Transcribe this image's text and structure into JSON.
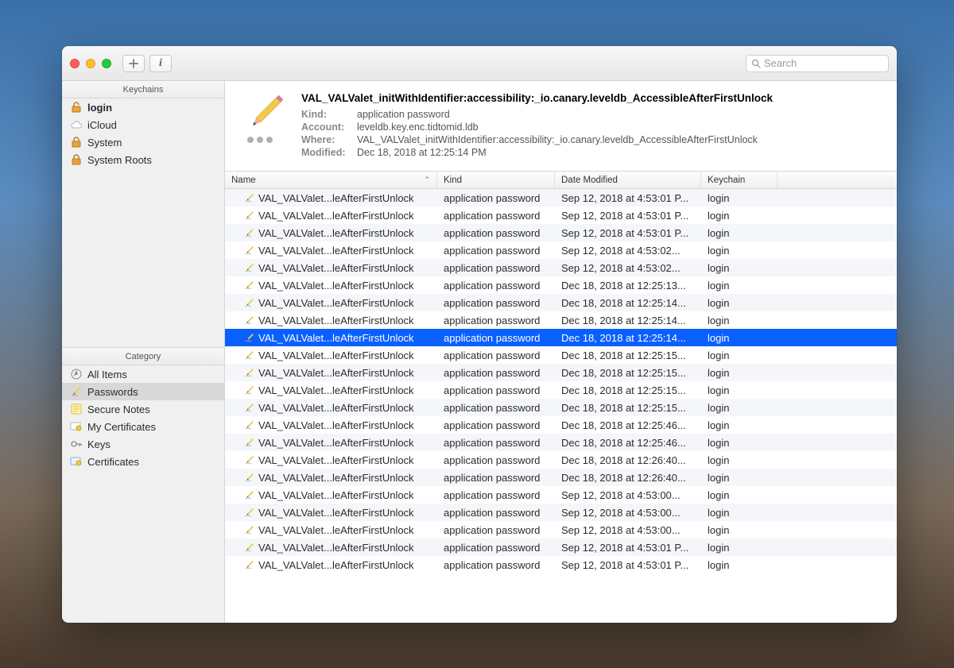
{
  "toolbar": {
    "search_placeholder": "Search"
  },
  "sidebar": {
    "keychains_header": "Keychains",
    "keychains": [
      {
        "label": "login",
        "icon": "lock-open",
        "bold": true
      },
      {
        "label": "iCloud",
        "icon": "cloud"
      },
      {
        "label": "System",
        "icon": "lock"
      },
      {
        "label": "System Roots",
        "icon": "lock"
      }
    ],
    "category_header": "Category",
    "categories": [
      {
        "label": "All Items",
        "icon": "compass",
        "selected": false
      },
      {
        "label": "Passwords",
        "icon": "pencil",
        "selected": true
      },
      {
        "label": "Secure Notes",
        "icon": "note",
        "selected": false
      },
      {
        "label": "My Certificates",
        "icon": "cert",
        "selected": false
      },
      {
        "label": "Keys",
        "icon": "key",
        "selected": false
      },
      {
        "label": "Certificates",
        "icon": "cert-blue",
        "selected": false
      }
    ]
  },
  "detail": {
    "title": "VAL_VALValet_initWithIdentifier:accessibility:_io.canary.leveldb_AccessibleAfterFirstUnlock",
    "kind_label": "Kind:",
    "kind_value": "application password",
    "account_label": "Account:",
    "account_value": "leveldb.key.enc.tidtomid.ldb",
    "where_label": "Where:",
    "where_value": "VAL_VALValet_initWithIdentifier:accessibility:_io.canary.leveldb_AccessibleAfterFirstUnlock",
    "modified_label": "Modified:",
    "modified_value": "Dec 18, 2018 at 12:25:14 PM"
  },
  "columns": {
    "name": "Name",
    "kind": "Kind",
    "date": "Date Modified",
    "keychain": "Keychain"
  },
  "rows": [
    {
      "name": "VAL_VALValet...leAfterFirstUnlock",
      "kind": "application password",
      "date": "Sep 12, 2018 at 4:53:01 P...",
      "keychain": "login"
    },
    {
      "name": "VAL_VALValet...leAfterFirstUnlock",
      "kind": "application password",
      "date": "Sep 12, 2018 at 4:53:01 P...",
      "keychain": "login"
    },
    {
      "name": "VAL_VALValet...leAfterFirstUnlock",
      "kind": "application password",
      "date": "Sep 12, 2018 at 4:53:01 P...",
      "keychain": "login"
    },
    {
      "name": "VAL_VALValet...leAfterFirstUnlock",
      "kind": "application password",
      "date": "Sep 12, 2018 at 4:53:02...",
      "keychain": "login"
    },
    {
      "name": "VAL_VALValet...leAfterFirstUnlock",
      "kind": "application password",
      "date": "Sep 12, 2018 at 4:53:02...",
      "keychain": "login"
    },
    {
      "name": "VAL_VALValet...leAfterFirstUnlock",
      "kind": "application password",
      "date": "Dec 18, 2018 at 12:25:13...",
      "keychain": "login"
    },
    {
      "name": "VAL_VALValet...leAfterFirstUnlock",
      "kind": "application password",
      "date": "Dec 18, 2018 at 12:25:14...",
      "keychain": "login"
    },
    {
      "name": "VAL_VALValet...leAfterFirstUnlock",
      "kind": "application password",
      "date": "Dec 18, 2018 at 12:25:14...",
      "keychain": "login"
    },
    {
      "name": "VAL_VALValet...leAfterFirstUnlock",
      "kind": "application password",
      "date": "Dec 18, 2018 at 12:25:14...",
      "keychain": "login",
      "selected": true
    },
    {
      "name": "VAL_VALValet...leAfterFirstUnlock",
      "kind": "application password",
      "date": "Dec 18, 2018 at 12:25:15...",
      "keychain": "login"
    },
    {
      "name": "VAL_VALValet...leAfterFirstUnlock",
      "kind": "application password",
      "date": "Dec 18, 2018 at 12:25:15...",
      "keychain": "login"
    },
    {
      "name": "VAL_VALValet...leAfterFirstUnlock",
      "kind": "application password",
      "date": "Dec 18, 2018 at 12:25:15...",
      "keychain": "login"
    },
    {
      "name": "VAL_VALValet...leAfterFirstUnlock",
      "kind": "application password",
      "date": "Dec 18, 2018 at 12:25:15...",
      "keychain": "login"
    },
    {
      "name": "VAL_VALValet...leAfterFirstUnlock",
      "kind": "application password",
      "date": "Dec 18, 2018 at 12:25:46...",
      "keychain": "login"
    },
    {
      "name": "VAL_VALValet...leAfterFirstUnlock",
      "kind": "application password",
      "date": "Dec 18, 2018 at 12:25:46...",
      "keychain": "login"
    },
    {
      "name": "VAL_VALValet...leAfterFirstUnlock",
      "kind": "application password",
      "date": "Dec 18, 2018 at 12:26:40...",
      "keychain": "login"
    },
    {
      "name": "VAL_VALValet...leAfterFirstUnlock",
      "kind": "application password",
      "date": "Dec 18, 2018 at 12:26:40...",
      "keychain": "login"
    },
    {
      "name": "VAL_VALValet...leAfterFirstUnlock",
      "kind": "application password",
      "date": "Sep 12, 2018 at 4:53:00...",
      "keychain": "login"
    },
    {
      "name": "VAL_VALValet...leAfterFirstUnlock",
      "kind": "application password",
      "date": "Sep 12, 2018 at 4:53:00...",
      "keychain": "login"
    },
    {
      "name": "VAL_VALValet...leAfterFirstUnlock",
      "kind": "application password",
      "date": "Sep 12, 2018 at 4:53:00...",
      "keychain": "login"
    },
    {
      "name": "VAL_VALValet...leAfterFirstUnlock",
      "kind": "application password",
      "date": "Sep 12, 2018 at 4:53:01 P...",
      "keychain": "login"
    },
    {
      "name": "VAL_VALValet...leAfterFirstUnlock",
      "kind": "application password",
      "date": "Sep 12, 2018 at 4:53:01 P...",
      "keychain": "login"
    }
  ]
}
